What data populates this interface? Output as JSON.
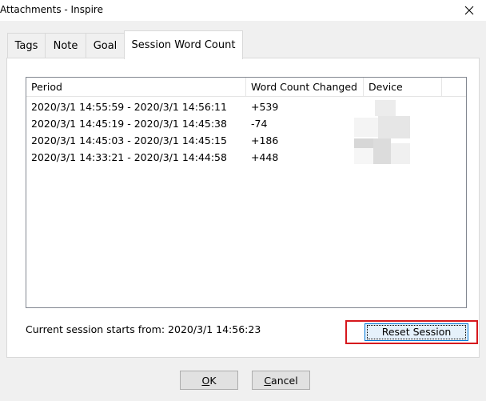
{
  "window": {
    "title": "Attachments - Inspire"
  },
  "tabs": [
    {
      "label": "Tags"
    },
    {
      "label": "Note"
    },
    {
      "label": "Goal"
    },
    {
      "label": "Session Word Count"
    }
  ],
  "list": {
    "columns": [
      "Period",
      "Word Count Changed",
      "Device"
    ],
    "rows": [
      {
        "period": "2020/3/1 14:55:59 - 2020/3/1 14:56:11",
        "change": "+539"
      },
      {
        "period": "2020/3/1 14:45:19 - 2020/3/1 14:45:38",
        "change": "-74"
      },
      {
        "period": "2020/3/1 14:45:03 - 2020/3/1 14:45:15",
        "change": "+186"
      },
      {
        "period": "2020/3/1 14:33:21 - 2020/3/1 14:44:58",
        "change": "+448"
      }
    ]
  },
  "session": {
    "text": "Current session starts from: 2020/3/1 14:56:23",
    "reset_label": "Reset Session"
  },
  "buttons": {
    "ok_first": "O",
    "ok_rest": "K",
    "cancel_first": "C",
    "cancel_rest": "ancel"
  },
  "colors": {
    "highlight": "#d6171d",
    "accent": "#0078d7"
  }
}
